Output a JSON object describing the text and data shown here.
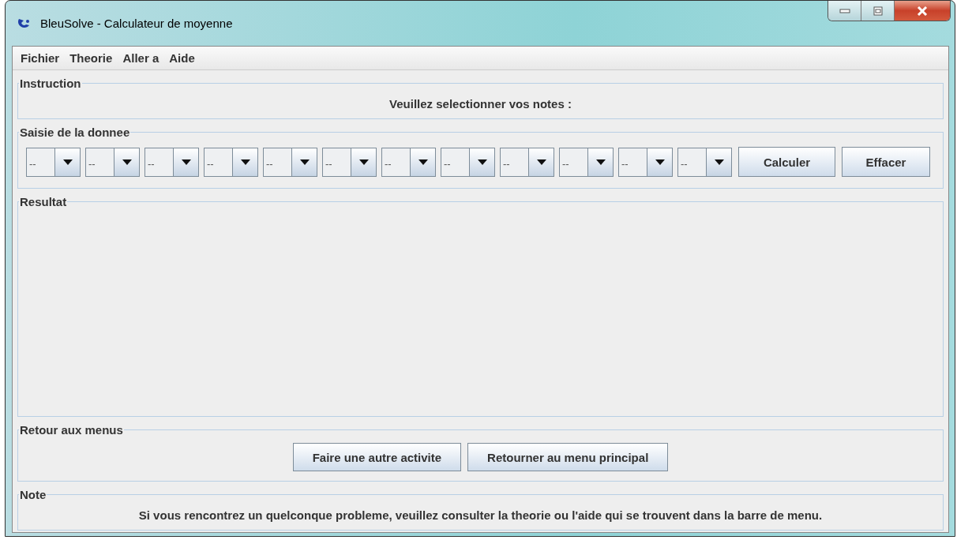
{
  "window": {
    "title": "BleuSolve - Calculateur de moyenne"
  },
  "menu": [
    "Fichier",
    "Theorie",
    "Aller a",
    "Aide"
  ],
  "instruction": {
    "title": "Instruction",
    "text": "Veuillez selectionner vos notes :"
  },
  "input": {
    "title": "Saisie de la donnee",
    "selects": [
      "--",
      "--",
      "--",
      "--",
      "--",
      "--",
      "--",
      "--",
      "--",
      "--",
      "--",
      "--"
    ],
    "buttons": [
      "Calculer",
      "Effacer"
    ]
  },
  "result": {
    "title": "Resultat"
  },
  "back": {
    "title": "Retour aux menus",
    "buttons": [
      "Faire une autre activite",
      "Retourner au menu principal"
    ]
  },
  "note": {
    "title": "Note",
    "text": "Si vous rencontrez un quelconque probleme, veuillez consulter la theorie ou l'aide qui se trouvent dans la barre de menu."
  }
}
